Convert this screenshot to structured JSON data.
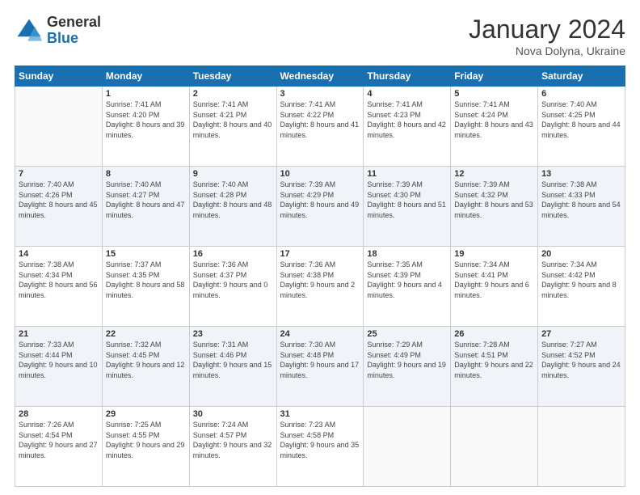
{
  "logo": {
    "general": "General",
    "blue": "Blue"
  },
  "title": "January 2024",
  "location": "Nova Dolyna, Ukraine",
  "days_of_week": [
    "Sunday",
    "Monday",
    "Tuesday",
    "Wednesday",
    "Thursday",
    "Friday",
    "Saturday"
  ],
  "weeks": [
    [
      {
        "day": "",
        "sunrise": "",
        "sunset": "",
        "daylight": ""
      },
      {
        "day": "1",
        "sunrise": "Sunrise: 7:41 AM",
        "sunset": "Sunset: 4:20 PM",
        "daylight": "Daylight: 8 hours and 39 minutes."
      },
      {
        "day": "2",
        "sunrise": "Sunrise: 7:41 AM",
        "sunset": "Sunset: 4:21 PM",
        "daylight": "Daylight: 8 hours and 40 minutes."
      },
      {
        "day": "3",
        "sunrise": "Sunrise: 7:41 AM",
        "sunset": "Sunset: 4:22 PM",
        "daylight": "Daylight: 8 hours and 41 minutes."
      },
      {
        "day": "4",
        "sunrise": "Sunrise: 7:41 AM",
        "sunset": "Sunset: 4:23 PM",
        "daylight": "Daylight: 8 hours and 42 minutes."
      },
      {
        "day": "5",
        "sunrise": "Sunrise: 7:41 AM",
        "sunset": "Sunset: 4:24 PM",
        "daylight": "Daylight: 8 hours and 43 minutes."
      },
      {
        "day": "6",
        "sunrise": "Sunrise: 7:40 AM",
        "sunset": "Sunset: 4:25 PM",
        "daylight": "Daylight: 8 hours and 44 minutes."
      }
    ],
    [
      {
        "day": "7",
        "sunrise": "Sunrise: 7:40 AM",
        "sunset": "Sunset: 4:26 PM",
        "daylight": "Daylight: 8 hours and 45 minutes."
      },
      {
        "day": "8",
        "sunrise": "Sunrise: 7:40 AM",
        "sunset": "Sunset: 4:27 PM",
        "daylight": "Daylight: 8 hours and 47 minutes."
      },
      {
        "day": "9",
        "sunrise": "Sunrise: 7:40 AM",
        "sunset": "Sunset: 4:28 PM",
        "daylight": "Daylight: 8 hours and 48 minutes."
      },
      {
        "day": "10",
        "sunrise": "Sunrise: 7:39 AM",
        "sunset": "Sunset: 4:29 PM",
        "daylight": "Daylight: 8 hours and 49 minutes."
      },
      {
        "day": "11",
        "sunrise": "Sunrise: 7:39 AM",
        "sunset": "Sunset: 4:30 PM",
        "daylight": "Daylight: 8 hours and 51 minutes."
      },
      {
        "day": "12",
        "sunrise": "Sunrise: 7:39 AM",
        "sunset": "Sunset: 4:32 PM",
        "daylight": "Daylight: 8 hours and 53 minutes."
      },
      {
        "day": "13",
        "sunrise": "Sunrise: 7:38 AM",
        "sunset": "Sunset: 4:33 PM",
        "daylight": "Daylight: 8 hours and 54 minutes."
      }
    ],
    [
      {
        "day": "14",
        "sunrise": "Sunrise: 7:38 AM",
        "sunset": "Sunset: 4:34 PM",
        "daylight": "Daylight: 8 hours and 56 minutes."
      },
      {
        "day": "15",
        "sunrise": "Sunrise: 7:37 AM",
        "sunset": "Sunset: 4:35 PM",
        "daylight": "Daylight: 8 hours and 58 minutes."
      },
      {
        "day": "16",
        "sunrise": "Sunrise: 7:36 AM",
        "sunset": "Sunset: 4:37 PM",
        "daylight": "Daylight: 9 hours and 0 minutes."
      },
      {
        "day": "17",
        "sunrise": "Sunrise: 7:36 AM",
        "sunset": "Sunset: 4:38 PM",
        "daylight": "Daylight: 9 hours and 2 minutes."
      },
      {
        "day": "18",
        "sunrise": "Sunrise: 7:35 AM",
        "sunset": "Sunset: 4:39 PM",
        "daylight": "Daylight: 9 hours and 4 minutes."
      },
      {
        "day": "19",
        "sunrise": "Sunrise: 7:34 AM",
        "sunset": "Sunset: 4:41 PM",
        "daylight": "Daylight: 9 hours and 6 minutes."
      },
      {
        "day": "20",
        "sunrise": "Sunrise: 7:34 AM",
        "sunset": "Sunset: 4:42 PM",
        "daylight": "Daylight: 9 hours and 8 minutes."
      }
    ],
    [
      {
        "day": "21",
        "sunrise": "Sunrise: 7:33 AM",
        "sunset": "Sunset: 4:44 PM",
        "daylight": "Daylight: 9 hours and 10 minutes."
      },
      {
        "day": "22",
        "sunrise": "Sunrise: 7:32 AM",
        "sunset": "Sunset: 4:45 PM",
        "daylight": "Daylight: 9 hours and 12 minutes."
      },
      {
        "day": "23",
        "sunrise": "Sunrise: 7:31 AM",
        "sunset": "Sunset: 4:46 PM",
        "daylight": "Daylight: 9 hours and 15 minutes."
      },
      {
        "day": "24",
        "sunrise": "Sunrise: 7:30 AM",
        "sunset": "Sunset: 4:48 PM",
        "daylight": "Daylight: 9 hours and 17 minutes."
      },
      {
        "day": "25",
        "sunrise": "Sunrise: 7:29 AM",
        "sunset": "Sunset: 4:49 PM",
        "daylight": "Daylight: 9 hours and 19 minutes."
      },
      {
        "day": "26",
        "sunrise": "Sunrise: 7:28 AM",
        "sunset": "Sunset: 4:51 PM",
        "daylight": "Daylight: 9 hours and 22 minutes."
      },
      {
        "day": "27",
        "sunrise": "Sunrise: 7:27 AM",
        "sunset": "Sunset: 4:52 PM",
        "daylight": "Daylight: 9 hours and 24 minutes."
      }
    ],
    [
      {
        "day": "28",
        "sunrise": "Sunrise: 7:26 AM",
        "sunset": "Sunset: 4:54 PM",
        "daylight": "Daylight: 9 hours and 27 minutes."
      },
      {
        "day": "29",
        "sunrise": "Sunrise: 7:25 AM",
        "sunset": "Sunset: 4:55 PM",
        "daylight": "Daylight: 9 hours and 29 minutes."
      },
      {
        "day": "30",
        "sunrise": "Sunrise: 7:24 AM",
        "sunset": "Sunset: 4:57 PM",
        "daylight": "Daylight: 9 hours and 32 minutes."
      },
      {
        "day": "31",
        "sunrise": "Sunrise: 7:23 AM",
        "sunset": "Sunset: 4:58 PM",
        "daylight": "Daylight: 9 hours and 35 minutes."
      },
      {
        "day": "",
        "sunrise": "",
        "sunset": "",
        "daylight": ""
      },
      {
        "day": "",
        "sunrise": "",
        "sunset": "",
        "daylight": ""
      },
      {
        "day": "",
        "sunrise": "",
        "sunset": "",
        "daylight": ""
      }
    ]
  ]
}
